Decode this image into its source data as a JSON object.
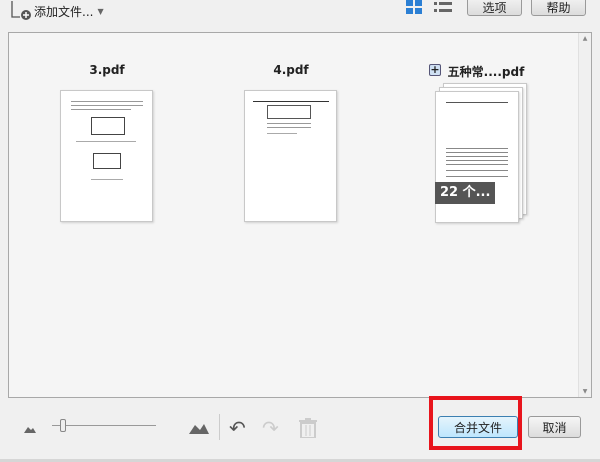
{
  "toolbar": {
    "add_files_label": "添加文件...",
    "options_label": "选项",
    "help_label": "帮助"
  },
  "files": [
    {
      "name": "3.pdf"
    },
    {
      "name": "4.pdf"
    },
    {
      "name": "五种常....pdf",
      "page_count_badge": "22 个..."
    }
  ],
  "footer": {
    "combine_label": "合并文件",
    "cancel_label": "取消"
  },
  "zoom_slider": {
    "value": 0.08
  },
  "colors": {
    "accent": "#2b7fd4",
    "highlight": "#e8141c"
  }
}
